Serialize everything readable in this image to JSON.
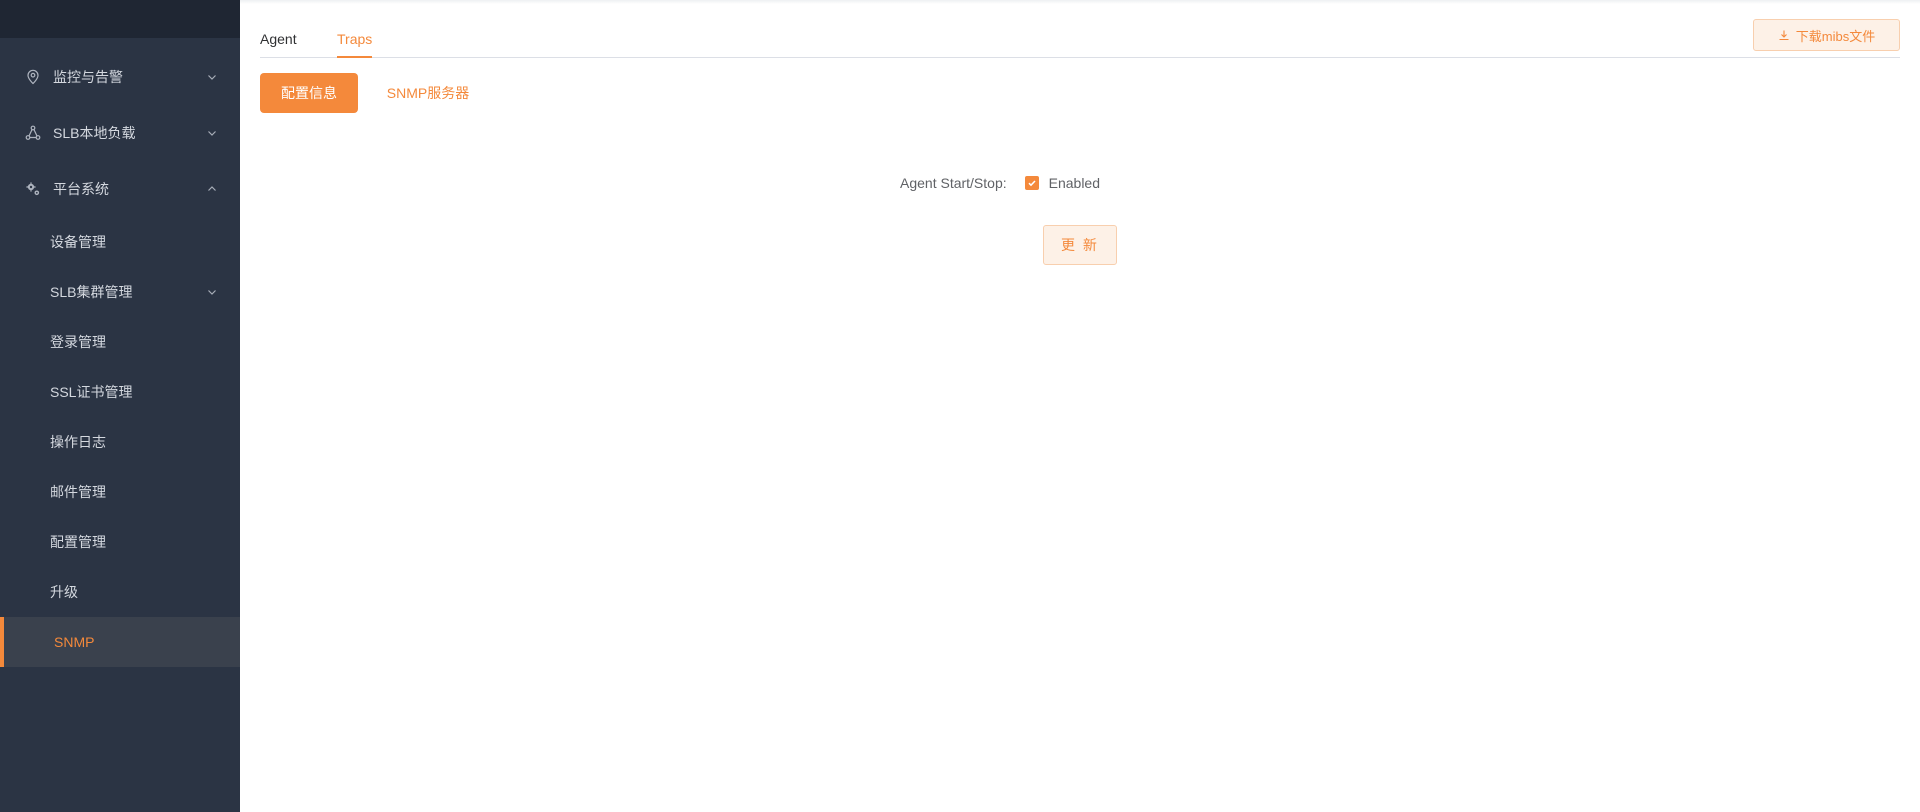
{
  "sidebar": {
    "groups": [
      {
        "label": "监控与告警",
        "icon": "location-pin-icon",
        "expanded": false
      },
      {
        "label": "SLB本地负载",
        "icon": "network-nodes-icon",
        "expanded": false
      },
      {
        "label": "平台系统",
        "icon": "gears-icon",
        "expanded": true
      }
    ],
    "items": [
      {
        "label": "设备管理"
      },
      {
        "label": "SLB集群管理",
        "has_children": true
      },
      {
        "label": "登录管理"
      },
      {
        "label": "SSL证书管理"
      },
      {
        "label": "操作日志"
      },
      {
        "label": "邮件管理"
      },
      {
        "label": "配置管理"
      },
      {
        "label": "升级"
      },
      {
        "label": "SNMP",
        "active": true
      }
    ]
  },
  "tabs": [
    {
      "label": "Agent",
      "active": false
    },
    {
      "label": "Traps",
      "active": true
    }
  ],
  "download_button": {
    "label": "下载mibs文件",
    "icon": "download-icon"
  },
  "subtabs": {
    "config_label": "配置信息",
    "server_label": "SNMP服务器"
  },
  "form": {
    "agent_label": "Agent Start/Stop:",
    "checkbox_label": "Enabled",
    "checked": true,
    "update_label": "更 新"
  },
  "colors": {
    "accent": "#f4893b",
    "sidebar_bg": "#2b3444",
    "sidebar_active_bg": "#3a414d"
  }
}
